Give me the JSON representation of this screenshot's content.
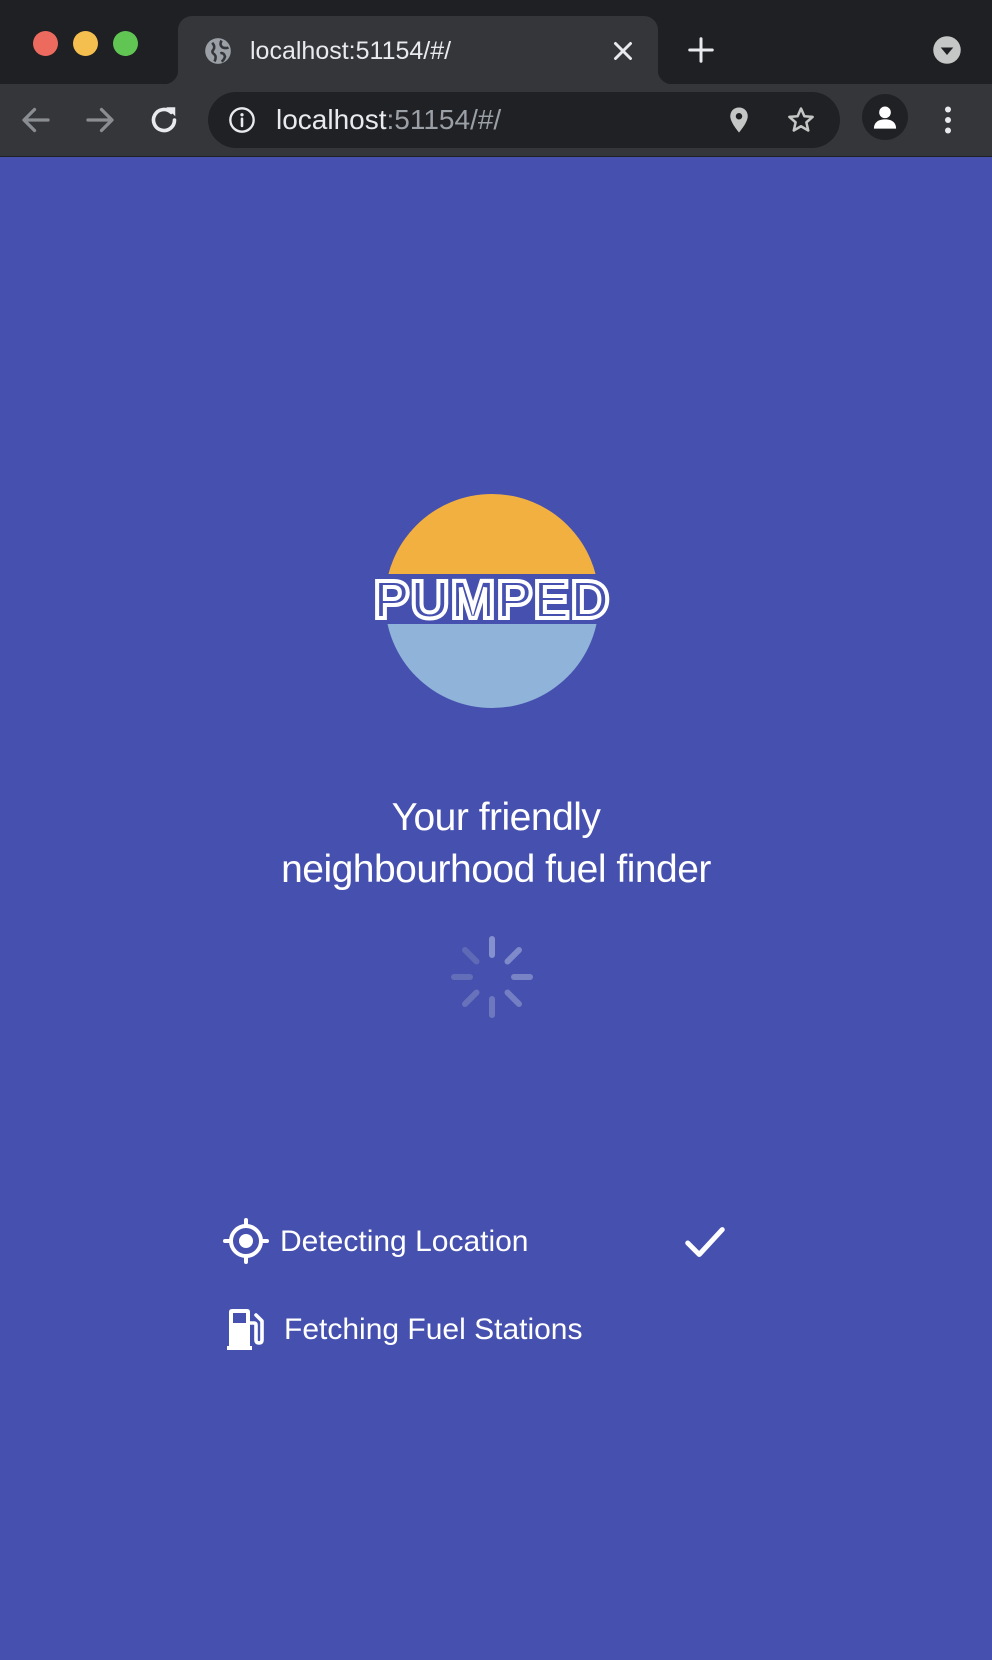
{
  "browser": {
    "tab": {
      "title": "localhost:51154/#/",
      "favicon": "globe-icon"
    },
    "omnibox": {
      "host": "localhost",
      "path": ":51154/#/"
    },
    "toolbar_icons": [
      "back-arrow-icon",
      "forward-arrow-icon",
      "reload-icon",
      "info-icon",
      "location-pin-icon",
      "star-icon",
      "profile-icon",
      "kebab-menu-icon"
    ]
  },
  "app": {
    "logo_text": "PUMPED",
    "tagline_line1": "Your friendly",
    "tagline_line2": "neighbourhood fuel finder",
    "loading_indicator": "spinner",
    "status": [
      {
        "label": "Detecting Location",
        "icon": "crosshair-icon",
        "done": true
      },
      {
        "label": "Fetching Fuel Stations",
        "icon": "fuel-pump-icon",
        "done": false
      }
    ]
  },
  "colors": {
    "page_background": "#4550af",
    "logo_sun": "#f2b041",
    "logo_water": "#8fb3d9",
    "browser_chrome": "#35363a"
  }
}
